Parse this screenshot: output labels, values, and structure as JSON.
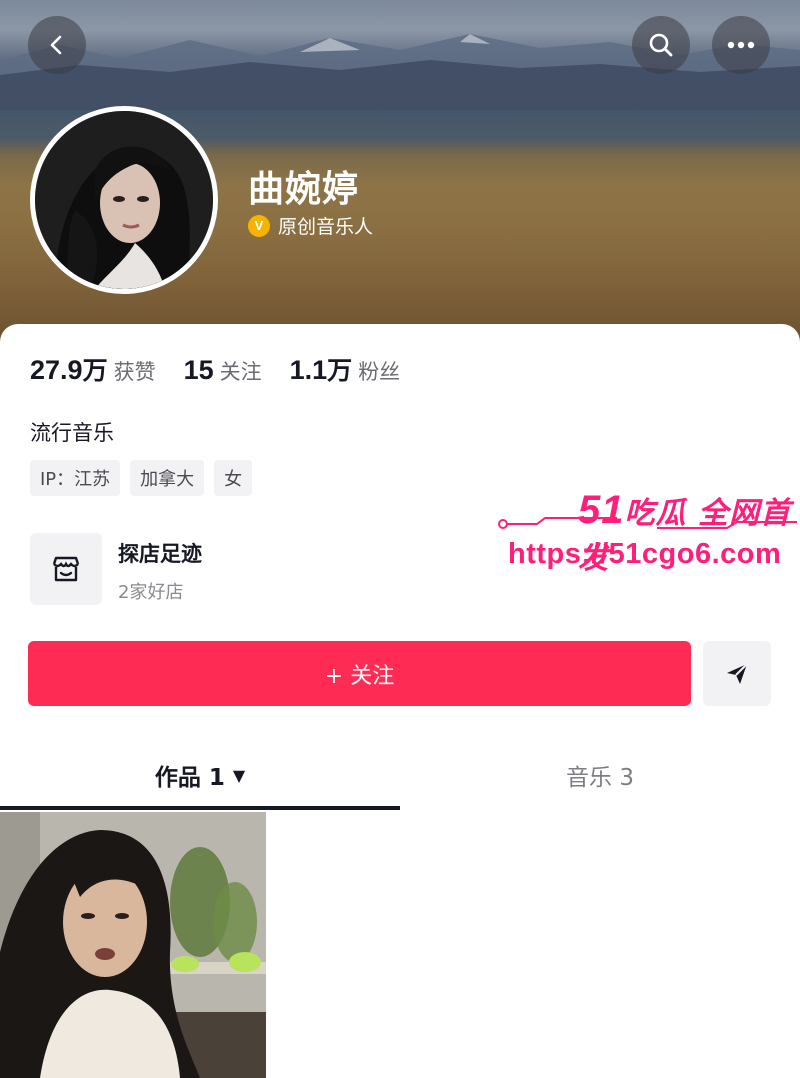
{
  "header": {
    "back_icon": "back-arrow-icon",
    "search_icon": "search-icon",
    "more_icon": "more-dots-icon"
  },
  "profile": {
    "name": "曲婉婷",
    "verify_badge": "V",
    "verify_label": "原创音乐人",
    "avatar_alt": "avatar"
  },
  "stats": [
    {
      "num": "27.9",
      "unit": "万",
      "label": "获赞"
    },
    {
      "num": "15",
      "unit": "",
      "label": "关注"
    },
    {
      "num": "1.1",
      "unit": "万",
      "label": "粉丝"
    }
  ],
  "bio": "流行音乐",
  "tags": [
    "IP：江苏",
    "加拿大",
    "女"
  ],
  "shop": {
    "title": "探店足迹",
    "subtitle": "2家好店",
    "icon": "shop-icon"
  },
  "watermark": {
    "line1_num": "51",
    "line1_text": "吃瓜 全网首发",
    "line2": "https://51cgo6.com"
  },
  "actions": {
    "follow_label": "+ 关注",
    "share_icon": "send-icon"
  },
  "tabs": {
    "works_label": "作品 1",
    "works_caret": "▼",
    "music_label": "音乐 3"
  },
  "colors": {
    "accent": "#fe2c55",
    "watermark": "#ff1f7a",
    "badge": "#f6b400"
  }
}
